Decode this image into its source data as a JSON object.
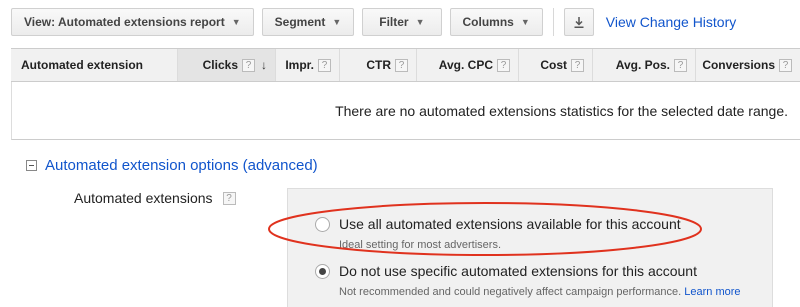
{
  "toolbar": {
    "view_label": "View: Automated extensions report",
    "segment_label": "Segment",
    "filter_label": "Filter",
    "columns_label": "Columns",
    "download_icon": "download-icon",
    "change_history_link": "View Change History"
  },
  "table": {
    "columns": [
      {
        "label": "Automated extension"
      },
      {
        "label": "Clicks",
        "help": "?",
        "sort": "↓"
      },
      {
        "label": "Impr.",
        "help": "?"
      },
      {
        "label": "CTR",
        "help": "?"
      },
      {
        "label": "Avg. CPC",
        "help": "?"
      },
      {
        "label": "Cost",
        "help": "?"
      },
      {
        "label": "Avg. Pos.",
        "help": "?"
      },
      {
        "label": "Conversions",
        "help": "?"
      }
    ],
    "empty_message": "There are no automated extensions statistics for the selected date range."
  },
  "options": {
    "section_title": "Automated extension options (advanced)",
    "field_label": "Automated extensions",
    "field_help": "?",
    "choices": [
      {
        "label": "Use all automated extensions available for this account",
        "description": "Ideal setting for most advertisers.",
        "checked": false
      },
      {
        "label": "Do not use specific automated extensions for this account",
        "description": "Not recommended and could negatively affect campaign performance.",
        "link": "Learn more",
        "checked": true
      }
    ]
  },
  "colors": {
    "link": "#1155cc",
    "annotation": "#e0321e"
  }
}
